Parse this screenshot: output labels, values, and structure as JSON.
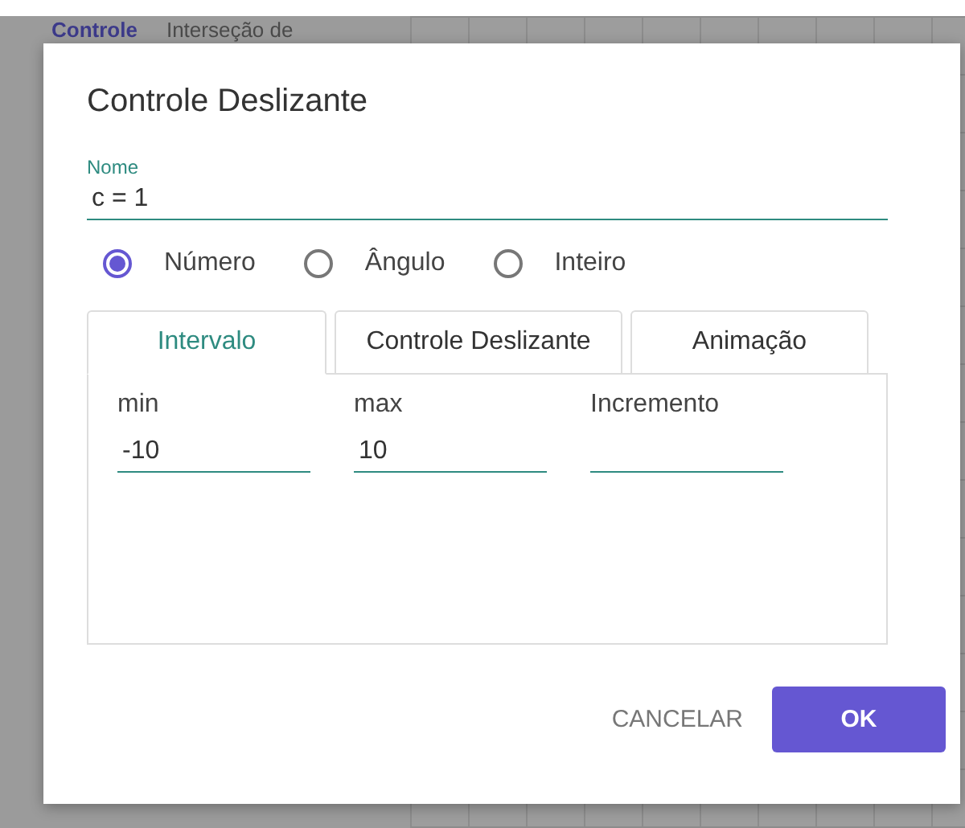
{
  "background": {
    "algebra_items": [
      {
        "name": "Controle",
        "description": "Interseção de"
      }
    ]
  },
  "dialog": {
    "title": "Controle Deslizante",
    "name_field": {
      "label": "Nome",
      "value": "c = 1"
    },
    "types": [
      {
        "label": "Número",
        "selected": true
      },
      {
        "label": "Ângulo",
        "selected": false
      },
      {
        "label": "Inteiro",
        "selected": false
      }
    ],
    "tabs": [
      {
        "label": "Intervalo",
        "selected": true
      },
      {
        "label": "Controle Deslizante",
        "selected": false
      },
      {
        "label": "Animação",
        "selected": false
      }
    ],
    "fields": [
      {
        "label": "min",
        "value": "-10"
      },
      {
        "label": "max",
        "value": "10"
      },
      {
        "label": "Incremento"
      }
    ],
    "buttons": [
      {
        "label": "CANCELAR",
        "kind": "text"
      },
      {
        "label": "OK",
        "kind": "primary"
      }
    ]
  }
}
